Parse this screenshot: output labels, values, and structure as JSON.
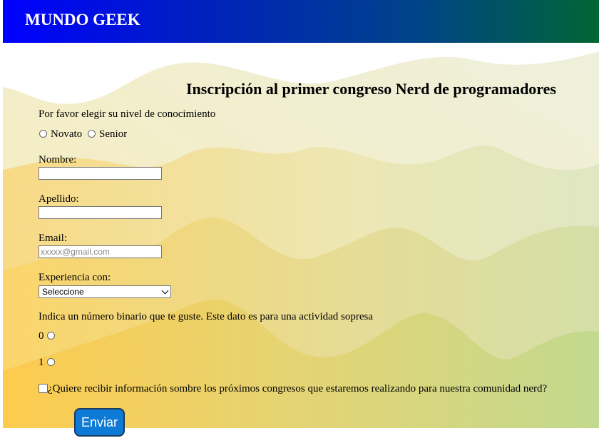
{
  "header": {
    "brand": "MUNDO GEEK"
  },
  "form": {
    "title": "Inscripción al primer congreso Nerd de programadores",
    "level_prompt": "Por favor elegir su nivel de conocimiento",
    "level_options": [
      "Novato",
      "Senior"
    ],
    "name_label": "Nombre:",
    "name_value": "",
    "lastname_label": "Apellido:",
    "lastname_value": "",
    "email_label": "Email:",
    "email_placeholder": "xxxxx@gmail.com",
    "experience_label": "Experiencia con:",
    "experience_selected": "Seleccione",
    "binary_prompt": "Indica un número binario que te guste. Este dato es para una actividad sopresa",
    "binary_options": [
      "0",
      "1"
    ],
    "newsletter_label": "¿Quiere recibir información sombre los próximos congresos que estaremos realizando para nuestra comunidad nerd?",
    "submit_label": "Enviar"
  },
  "colors": {
    "header_start": "#0000ff",
    "header_end": "#006633",
    "button": "#0d7ad6"
  }
}
